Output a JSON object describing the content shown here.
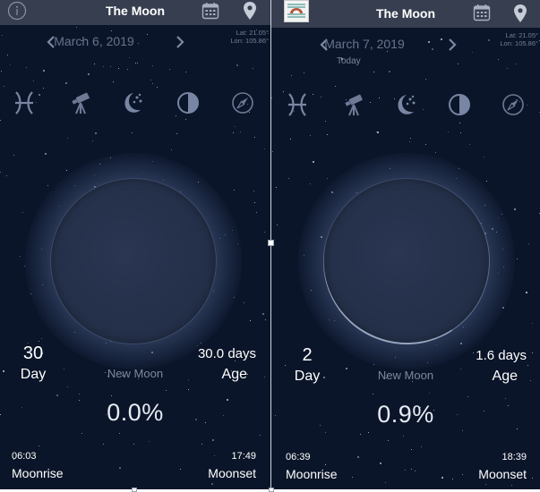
{
  "colors": {
    "background": "#0b1529",
    "navbar": "#363e4f",
    "icon": "#8a95ad",
    "muted_text": "#66738d",
    "text": "#ffffff"
  },
  "panels": [
    {
      "navbar": {
        "title": "The Moon",
        "left_icon": "info-icon",
        "icons": [
          "calendar-icon",
          "location-pin-icon"
        ]
      },
      "date": {
        "text": "March 6, 2019",
        "prev_icon": "chevron-left-icon",
        "next_icon": "chevron-right-icon",
        "subtitle": ""
      },
      "coords": {
        "lat": "Lat: 21.05°",
        "lon": "Lon: 105.86°"
      },
      "tools": [
        "zodiac-icon",
        "telescope-icon",
        "moon-stars-icon",
        "moon-phase-icon",
        "compass-icon"
      ],
      "moon": {
        "illumination_fraction": 0.0
      },
      "stats": {
        "day_value": "30",
        "day_label": "Day",
        "age_value": "30.0 days",
        "age_label": "Age",
        "phase_name": "New Moon",
        "illumination": "0.0%",
        "moonrise_time": "06:03",
        "moonrise_label": "Moonrise",
        "moonset_time": "17:49",
        "moonset_label": "Moonset"
      }
    },
    {
      "navbar": {
        "title": "The Moon",
        "left_icon": "reader-icon",
        "icons": [
          "calendar-icon",
          "location-pin-icon"
        ]
      },
      "date": {
        "text": "March 7, 2019",
        "prev_icon": "chevron-left-icon",
        "next_icon": "chevron-right-icon",
        "subtitle": "Today"
      },
      "coords": {
        "lat": "Lat: 21.05°",
        "lon": "Lon: 105.86°"
      },
      "tools": [
        "zodiac-icon",
        "telescope-icon",
        "moon-stars-icon",
        "moon-phase-icon",
        "compass-icon"
      ],
      "moon": {
        "illumination_fraction": 0.009
      },
      "stats": {
        "day_value": "2",
        "day_label": "Day",
        "age_value": "1.6 days",
        "age_label": "Age",
        "phase_name": "New Moon",
        "illumination": "0.9%",
        "moonrise_time": "06:39",
        "moonrise_label": "Moonrise",
        "moonset_time": "18:39",
        "moonset_label": "Moonset"
      }
    }
  ]
}
